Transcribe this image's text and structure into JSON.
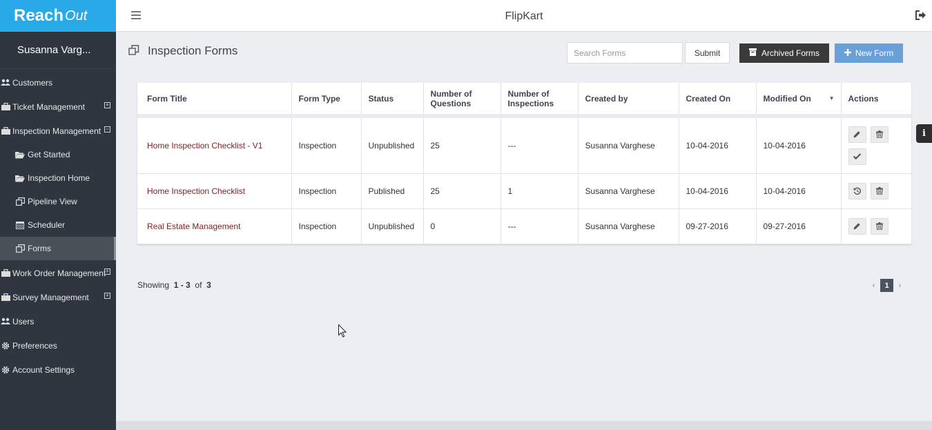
{
  "brand": {
    "logo_reach": "Reach",
    "logo_out": "Out"
  },
  "user": {
    "name": "Susanna Varg..."
  },
  "header": {
    "app_title": "FlipKart"
  },
  "sidebar": {
    "items": [
      {
        "label": "Customers",
        "icon": "users-icon"
      },
      {
        "label": "Ticket Management",
        "icon": "briefcase-icon",
        "expand": "+"
      },
      {
        "label": "Inspection Management",
        "icon": "briefcase-icon",
        "expand": "−"
      },
      {
        "label": "Work Order Management",
        "icon": "briefcase-icon",
        "expand": "+"
      },
      {
        "label": "Survey Management",
        "icon": "briefcase-icon",
        "expand": "+"
      },
      {
        "label": "Users",
        "icon": "users-icon"
      },
      {
        "label": "Preferences",
        "icon": "gear-icon"
      },
      {
        "label": "Account Settings",
        "icon": "gear-icon"
      }
    ],
    "sub_items": [
      {
        "label": "Get Started",
        "icon": "folder-open-icon"
      },
      {
        "label": "Inspection Home",
        "icon": "folder-open-icon"
      },
      {
        "label": "Pipeline View",
        "icon": "copy-icon"
      },
      {
        "label": "Scheduler",
        "icon": "calendar-icon"
      },
      {
        "label": "Forms",
        "icon": "copy-icon",
        "active": true
      }
    ]
  },
  "page": {
    "title": "Inspection Forms"
  },
  "toolbar": {
    "search_placeholder": "Search Forms",
    "submit_label": "Submit",
    "archived_label": "Archived Forms",
    "new_label": "New Form"
  },
  "table": {
    "headers": [
      "Form Title",
      "Form Type",
      "Status",
      "Number of Questions",
      "Number of Inspections",
      "Created by",
      "Created On",
      "Modified On",
      "Actions"
    ],
    "rows": [
      {
        "title": "Home Inspection Checklist - V1",
        "type": "Inspection",
        "status": "Unpublished",
        "questions": "25",
        "inspections": "---",
        "created_by": "Susanna Varghese",
        "created_on": "10-04-2016",
        "modified_on": "10-04-2016"
      },
      {
        "title": "Home Inspection Checklist",
        "type": "Inspection",
        "status": "Published",
        "questions": "25",
        "inspections": "1",
        "created_by": "Susanna Varghese",
        "created_on": "10-04-2016",
        "modified_on": "10-04-2016"
      },
      {
        "title": "Real Estate Management",
        "type": "Inspection",
        "status": "Unpublished",
        "questions": "0",
        "inspections": "---",
        "created_by": "Susanna Varghese",
        "created_on": "09-27-2016",
        "modified_on": "09-27-2016"
      }
    ]
  },
  "pagination": {
    "showing_label": "Showing",
    "range": "1 - 3",
    "of_label": "of",
    "total": "3",
    "prev": "‹",
    "current": "1",
    "next": "›"
  },
  "info_tab": {
    "label": "i"
  }
}
